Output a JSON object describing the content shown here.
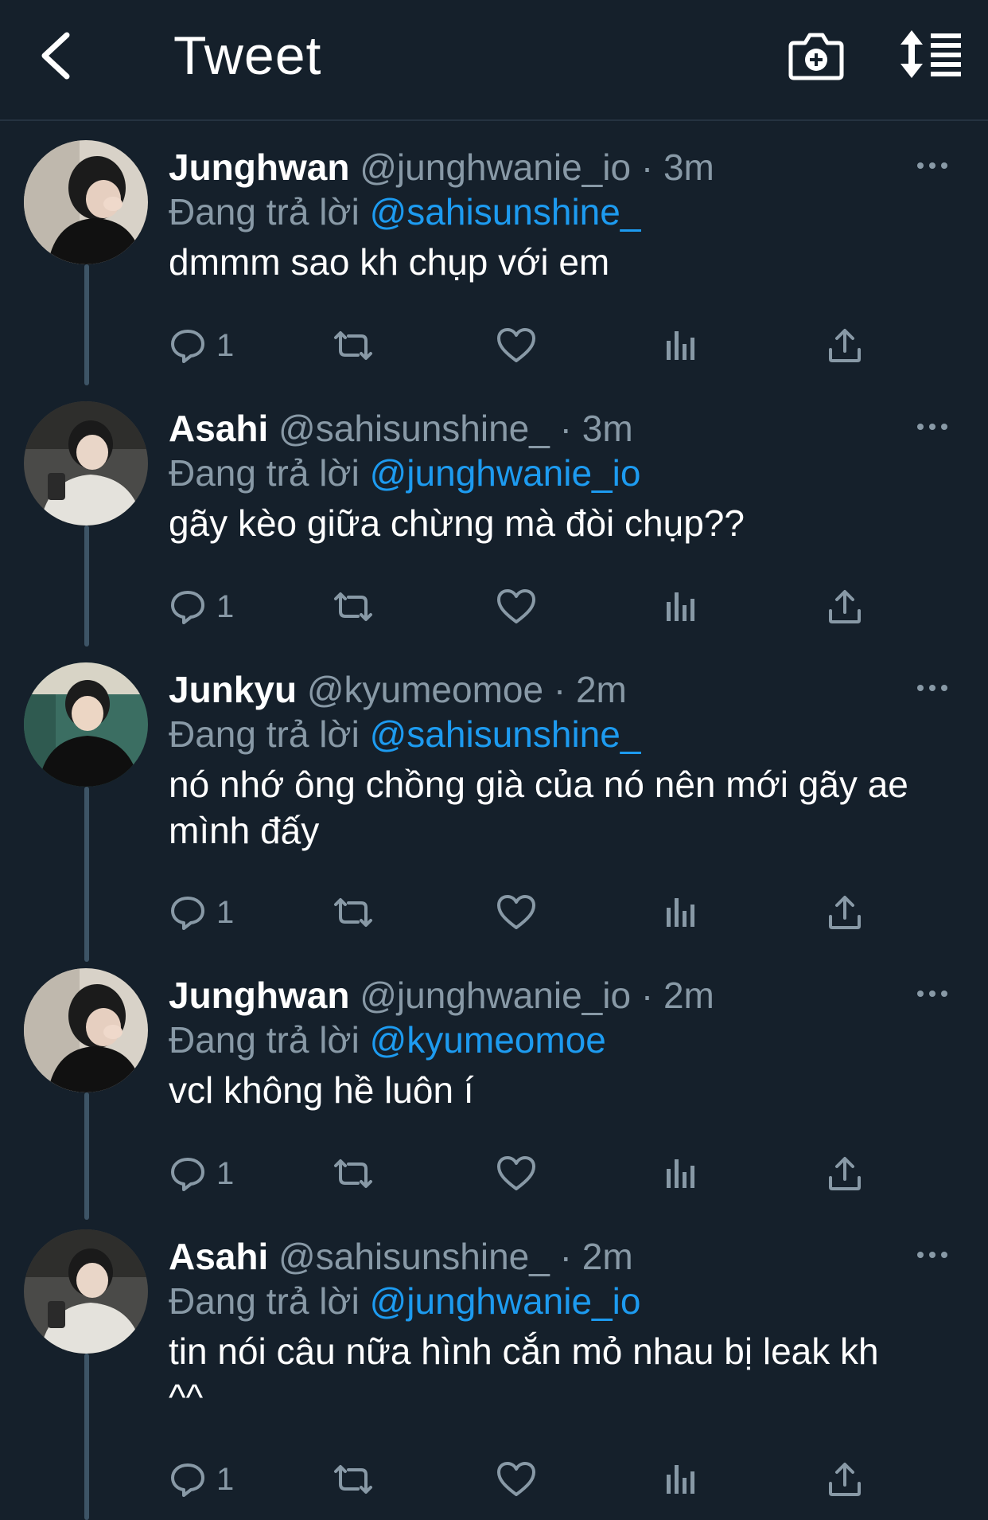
{
  "header": {
    "title": "Tweet",
    "back_icon": "chevron-left-icon",
    "camera_icon": "camera-plus-icon",
    "sort_icon": "sort-order-icon"
  },
  "reply_prefix": "Đang trả lời",
  "tweets": [
    {
      "name": "Junghwan",
      "handle": "@junghwanie_io",
      "separator": "·",
      "time": "3m",
      "reply_to": "@sahisunshine_",
      "text": "dmmm sao kh chụp với em",
      "reply_count": "1"
    },
    {
      "name": "Asahi",
      "handle": "@sahisunshine_",
      "separator": "·",
      "time": "3m",
      "reply_to": "@junghwanie_io",
      "text": "gãy kèo giữa chừng mà đòi chụp??",
      "reply_count": "1"
    },
    {
      "name": "Junkyu",
      "handle": "@kyumeomoe",
      "separator": "·",
      "time": "2m",
      "reply_to": "@sahisunshine_",
      "text_line1": "nó nhớ ông chồng già của nó nên mới gãy ae",
      "text_line2": "mình đấy",
      "reply_count": "1"
    },
    {
      "name": "Junghwan",
      "handle": "@junghwanie_io",
      "separator": "·",
      "time": "2m",
      "reply_to": "@kyumeomoe",
      "text": "vcl không hề luôn í",
      "reply_count": "1"
    },
    {
      "name": "Asahi",
      "handle": "@sahisunshine_",
      "separator": "·",
      "time": "2m",
      "reply_to": "@junghwanie_io",
      "text_line1": "tin nói câu nữa hình cắn mỏ nhau bị leak kh",
      "text_line2": "^^",
      "reply_count": "1"
    }
  ],
  "colors": {
    "background": "#15202b",
    "secondary_text": "#8899a6",
    "mention": "#1d9bf0",
    "thread_line": "#3d5466"
  }
}
